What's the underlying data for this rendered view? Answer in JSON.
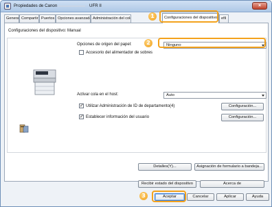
{
  "window": {
    "title_prefix": "Propiedades de Canon",
    "title_suffix": "UFR II",
    "close_glyph": "×"
  },
  "tabs": [
    {
      "label": "General"
    },
    {
      "label": "Compartir"
    },
    {
      "label": "Puertos"
    },
    {
      "label": "Opciones avanzadas"
    },
    {
      "label": "Administración del color"
    },
    {
      "label": "Configuraciones del dispositivo"
    },
    {
      "label": "efil"
    }
  ],
  "panel": {
    "heading": "Configuraciones del dispositivo: Manual"
  },
  "paper_source": {
    "label": "Opciones de origen del papel:",
    "value": "Ninguno"
  },
  "feeder_checkbox": {
    "label": "Accesorio del alimentador de sobres",
    "checked": false
  },
  "host_queue": {
    "label": "Activar cola en el host:",
    "value": "Auto"
  },
  "dept_checkbox": {
    "label": "Utilizar Administración de ID de departamento(4)",
    "checked": true,
    "button": "Configuración..."
  },
  "user_checkbox": {
    "label": "Establecer información del usuario",
    "checked": true,
    "button": "Configuración..."
  },
  "buttons": {
    "details": "Detalles(Y)...",
    "form_assign": "Asignación de formulario a bandeja...",
    "get_status": "Recibir estado del dispositivo",
    "about": "Acerca de",
    "ok": "Aceptar",
    "cancel": "Cancelar",
    "apply": "Aplicar",
    "help": "Ayuda"
  },
  "callouts": {
    "one": "1",
    "two": "2",
    "three": "3"
  },
  "colors": {
    "callout": "#f3a21c",
    "accent": "#3d7bd1"
  }
}
